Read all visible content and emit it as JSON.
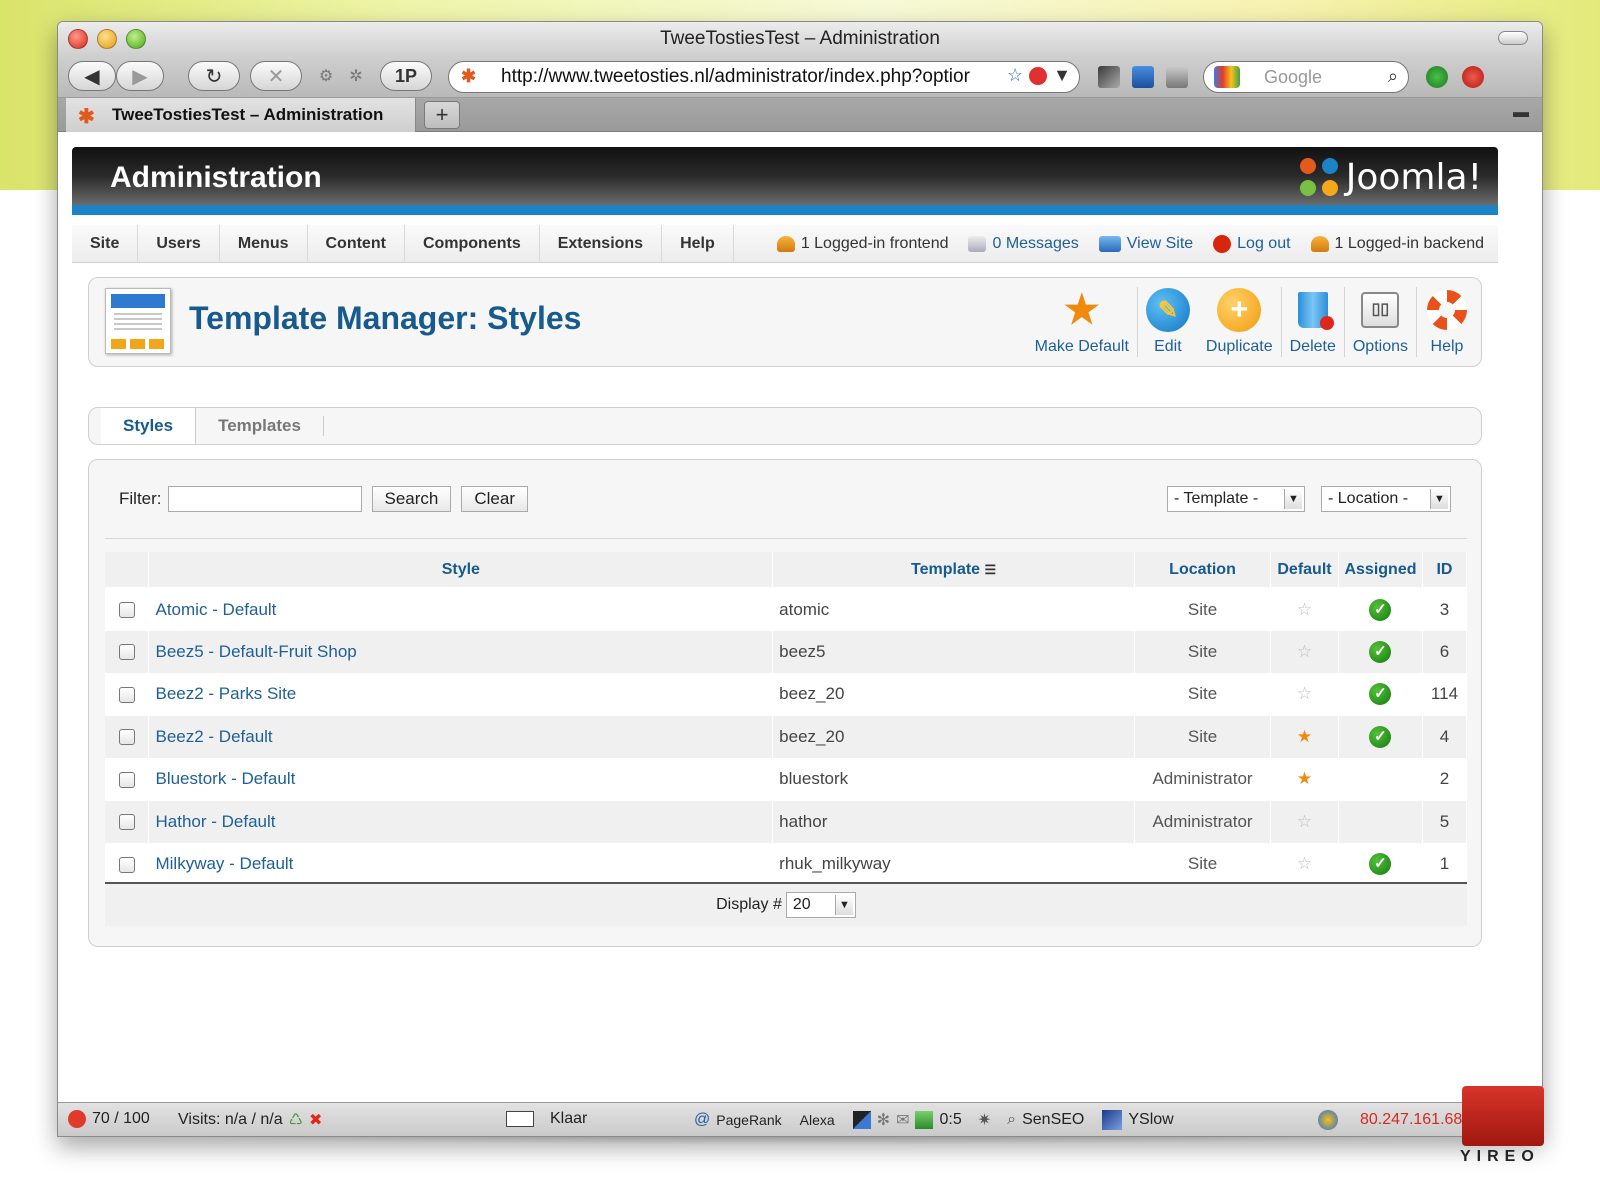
{
  "browser": {
    "window_title": "TweeTostiesTest – Administration",
    "url": "http://www.tweetosties.nl/administrator/index.php?optior",
    "search_placeholder": "Google",
    "onepassword_label": "1P",
    "tab_title": "TweeTostiesTest – Administration",
    "new_tab_label": "+"
  },
  "header": {
    "title": "Administration",
    "logo_text": "Joomla!"
  },
  "menu": {
    "items": [
      "Site",
      "Users",
      "Menus",
      "Content",
      "Components",
      "Extensions",
      "Help"
    ],
    "status": {
      "frontend": "1 Logged-in frontend",
      "messages": "0 Messages",
      "view_site": "View Site",
      "logout": "Log out",
      "backend": "1 Logged-in backend"
    }
  },
  "page": {
    "title": "Template Manager: Styles",
    "toolbar": {
      "make_default": "Make Default",
      "edit": "Edit",
      "duplicate": "Duplicate",
      "delete": "Delete",
      "options": "Options",
      "help": "Help"
    },
    "subtabs": [
      "Styles",
      "Templates"
    ]
  },
  "filter": {
    "label": "Filter:",
    "value": "",
    "search_button": "Search",
    "clear_button": "Clear",
    "template_select": "- Template -",
    "location_select": "- Location -"
  },
  "table": {
    "headers": {
      "style": "Style",
      "template": "Template",
      "location": "Location",
      "default": "Default",
      "assigned": "Assigned",
      "id": "ID"
    },
    "rows": [
      {
        "style": "Atomic - Default",
        "template": "atomic",
        "location": "Site",
        "default": false,
        "assigned": true,
        "id": "3"
      },
      {
        "style": "Beez5 - Default-Fruit Shop",
        "template": "beez5",
        "location": "Site",
        "default": false,
        "assigned": true,
        "id": "6"
      },
      {
        "style": "Beez2 - Parks Site",
        "template": "beez_20",
        "location": "Site",
        "default": false,
        "assigned": true,
        "id": "114"
      },
      {
        "style": "Beez2 - Default",
        "template": "beez_20",
        "location": "Site",
        "default": true,
        "assigned": true,
        "id": "4"
      },
      {
        "style": "Bluestork - Default",
        "template": "bluestork",
        "location": "Administrator",
        "default": true,
        "assigned": false,
        "id": "2"
      },
      {
        "style": "Hathor - Default",
        "template": "hathor",
        "location": "Administrator",
        "default": false,
        "assigned": false,
        "id": "5"
      },
      {
        "style": "Milkyway - Default",
        "template": "rhuk_milkyway",
        "location": "Site",
        "default": false,
        "assigned": true,
        "id": "1"
      }
    ],
    "display_label": "Display #",
    "display_value": "20"
  },
  "statusbar": {
    "score": "70 / 100",
    "visits": "Visits: n/a / n/a",
    "done": "Klaar",
    "pagerank": "PageRank",
    "alexa": "Alexa",
    "counter": "0:5",
    "senseo": "SenSEO",
    "yslow": "YSlow",
    "ip": "80.247.161.68"
  },
  "watermark": "YIREO",
  "colors": {
    "link_blue": "#1f5f98",
    "title_blue": "#165a8e",
    "header_bar": "#1a84c7",
    "star_orange": "#f08a0c",
    "check_green": "#2a9a1c"
  }
}
